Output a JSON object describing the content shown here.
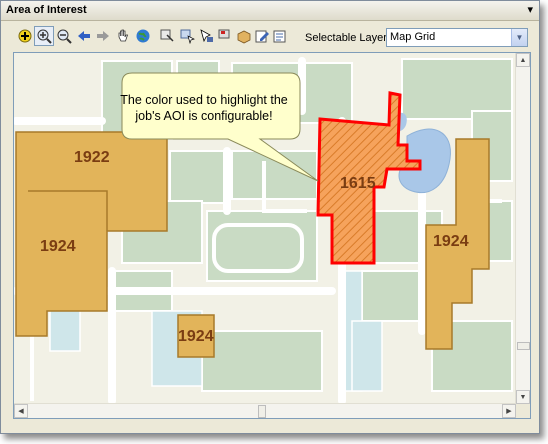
{
  "panel": {
    "title": "Area of Interest",
    "pin_icon": "pin-icon"
  },
  "toolbar": {
    "selectable_layer_label": "Selectable Layer:",
    "selectable_layer_value": "Map Grid",
    "tools": [
      "add-icon",
      "zoom-in-icon",
      "zoom-out-icon",
      "back-arrow-icon",
      "forward-arrow-icon",
      "pan-hand-icon",
      "globe-icon",
      "select-features-icon",
      "select-by-rect-icon",
      "select-pointer-icon",
      "flag-icon",
      "box-icon",
      "edit-pencil-icon",
      "edit-list-icon"
    ]
  },
  "map": {
    "parcels": [
      {
        "label": "1922"
      },
      {
        "label": "1924"
      },
      {
        "label": "1615"
      },
      {
        "label": "1924"
      },
      {
        "label": "1924"
      }
    ],
    "callout": {
      "text": "The color used to highlight the job's AOI is configurable!"
    },
    "colors": {
      "parcel": "#e2b45a",
      "highlight": "#ff0000",
      "water": "#a9c7e8",
      "park": "#c9dbc4",
      "road": "#ffffff"
    }
  }
}
